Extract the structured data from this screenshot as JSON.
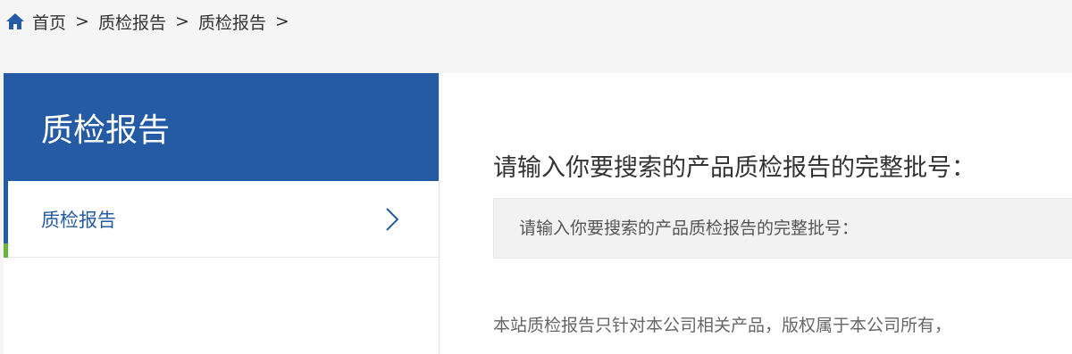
{
  "breadcrumb": {
    "home_icon": "home-icon",
    "items": [
      "首页",
      "质检报告",
      "质检报告"
    ],
    "separator": ">"
  },
  "sidebar": {
    "title": "质检报告",
    "items": [
      {
        "label": "质检报告",
        "icon": "chevron-right-icon"
      }
    ]
  },
  "main": {
    "heading": "请输入你要搜索的产品质检报告的完整批号：",
    "search": {
      "placeholder": "请输入你要搜索的产品质检报告的完整批号：",
      "value": ""
    },
    "notice": "本站质检报告只针对本公司相关产品，版权属于本公司所有，"
  },
  "colors": {
    "brand_blue": "#245ba4",
    "accent_green": "#6ab43e",
    "page_bg": "#f5f5f5"
  }
}
